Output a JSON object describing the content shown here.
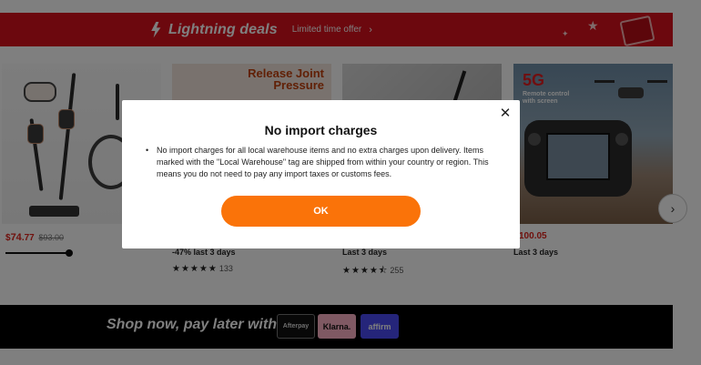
{
  "banner": {
    "title": "Lightning deals",
    "subtitle": "Limited time offer",
    "chevron": "›"
  },
  "products": [
    {
      "price_currency": "$",
      "price_main": "74",
      "price_cents": ".77",
      "price_original": "$93.00"
    },
    {
      "promo_title": "Release Joint",
      "promo_title_2": "Pressure",
      "subline": "-47% last 3 days",
      "rating_stars": "★★★★★",
      "rating_count": "133"
    },
    {
      "subline": "Last 3 days",
      "rating_stars": "★★★★⯪",
      "rating_count": "255"
    },
    {
      "label": "5G",
      "label_sub": "Remote control",
      "label_sub2": "with screen",
      "price_main": "100",
      "price_cents": ".05",
      "subline": "Last 3 days"
    }
  ],
  "carousel": {
    "next_icon": "›"
  },
  "bnpl": {
    "text": "Shop now, pay later with",
    "providers": [
      "Afterpay",
      "Klarna.",
      "affirm"
    ]
  },
  "modal": {
    "title": "No import charges",
    "body": "No import charges for all local warehouse items and no extra charges upon delivery. Items marked with the \"Local Warehouse\" tag are shipped from within your country or region. This means you do not need to pay any import taxes or customs fees.",
    "ok_label": "OK",
    "close_icon": "✕"
  },
  "colors": {
    "banner_red": "#d9101c",
    "ok_orange": "#fa7309",
    "price_red": "#e0231b"
  }
}
